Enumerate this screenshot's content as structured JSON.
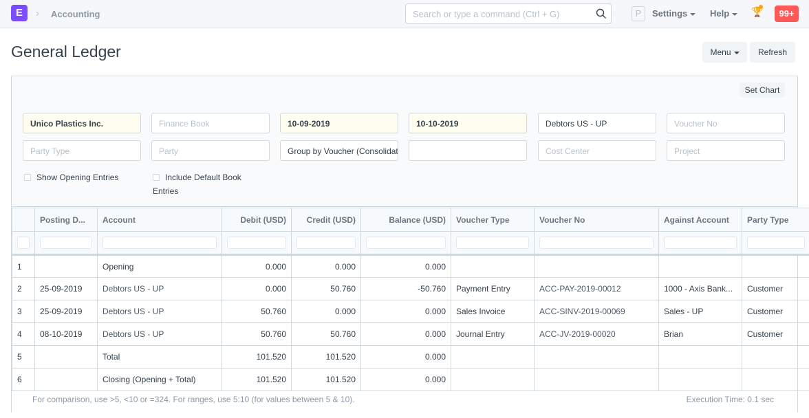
{
  "topbar": {
    "logo": "E",
    "breadcrumb": "Accounting",
    "search_placeholder": "Search or type a command (Ctrl + G)",
    "avatar": "P",
    "settings": "Settings",
    "help": "Help",
    "notifications": "99+"
  },
  "page": {
    "title": "General Ledger",
    "menu": "Menu",
    "refresh": "Refresh",
    "set_chart": "Set Chart"
  },
  "filters": {
    "company": "Unico Plastics Inc.",
    "finance_book": "Finance Book",
    "from_date": "10-09-2019",
    "to_date": "10-10-2019",
    "account": "Debtors US - UP",
    "voucher_no": "Voucher No",
    "party_type": "Party Type",
    "party": "Party",
    "group_by": "Group by Voucher (Consolidated)",
    "blank": "",
    "cost_center": "Cost Center",
    "project": "Project",
    "show_opening": "Show Opening Entries",
    "include_default": "Include Default Book Entries"
  },
  "table": {
    "columns": [
      "",
      "Posting D...",
      "Account",
      "Debit (USD)",
      "Credit (USD)",
      "Balance (USD)",
      "Voucher Type",
      "Voucher No",
      "Against Account",
      "Party Type"
    ],
    "rows": [
      [
        "1",
        "",
        "Opening",
        "0.000",
        "0.000",
        "0.000",
        "",
        "",
        "",
        ""
      ],
      [
        "2",
        "25-09-2019",
        "Debtors US - UP",
        "0.000",
        "50.760",
        "-50.760",
        "Payment Entry",
        "ACC-PAY-2019-00012",
        "1000 - Axis Bank...",
        "Customer"
      ],
      [
        "3",
        "25-09-2019",
        "Debtors US - UP",
        "50.760",
        "0.000",
        "0.000",
        "Sales Invoice",
        "ACC-SINV-2019-00069",
        "Sales - UP",
        "Customer"
      ],
      [
        "4",
        "08-10-2019",
        "Debtors US - UP",
        "50.760",
        "50.760",
        "0.000",
        "Journal Entry",
        "ACC-JV-2019-00020",
        "Brian",
        "Customer"
      ],
      [
        "5",
        "",
        "Total",
        "101.520",
        "101.520",
        "0.000",
        "",
        "",
        "",
        ""
      ],
      [
        "6",
        "",
        "Closing (Opening + Total)",
        "101.520",
        "101.520",
        "0.000",
        "",
        "",
        "",
        ""
      ]
    ]
  },
  "footer": {
    "hint": "For comparison, use >5, <10 or =324. For ranges, use 5:10 (for values between 5 & 10).",
    "execution": "Execution Time: 0.1 sec"
  }
}
